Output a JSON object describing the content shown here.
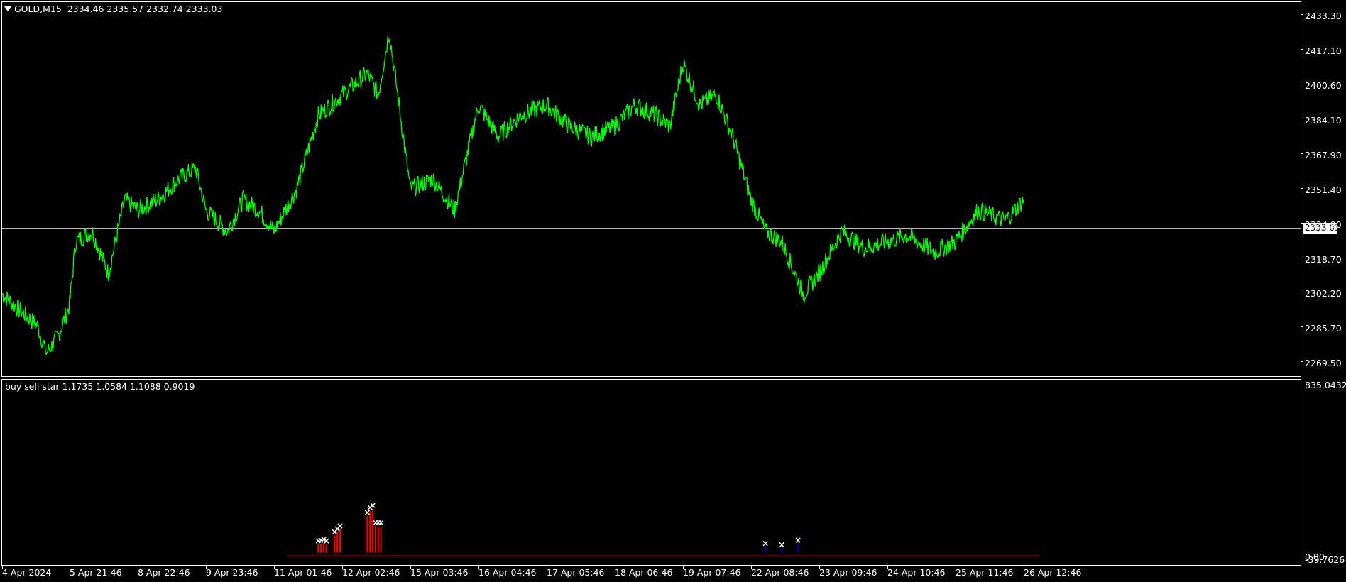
{
  "main_panel": {
    "symbol": "GOLD,M15",
    "ohlc": "2334.46 2335.57 2332.74 2333.03",
    "current_price_label": "2333.03",
    "y_ticks": [
      "2433.30",
      "2417.10",
      "2400.60",
      "2384.10",
      "2367.90",
      "2351.40",
      "2334.90",
      "2318.70",
      "2302.20",
      "2285.70",
      "2269.50"
    ]
  },
  "indicator_panel": {
    "title": "buy sell star 1.1735 1.0584 1.1088 0.9019",
    "y_top": "835.0432",
    "y_bottom": "-39.7626",
    "y_zero": "0.00"
  },
  "x_ticks": [
    "4 Apr 2024",
    "5 Apr 21:46",
    "8 Apr 22:46",
    "9 Apr 23:46",
    "11 Apr 01:46",
    "12 Apr 02:46",
    "15 Apr 03:46",
    "16 Apr 04:46",
    "17 Apr 05:46",
    "18 Apr 06:46",
    "19 Apr 07:46",
    "22 Apr 08:46",
    "23 Apr 09:46",
    "24 Apr 10:46",
    "25 Apr 11:46",
    "26 Apr 12:46"
  ],
  "chart_data": [
    {
      "type": "line",
      "title": "GOLD,M15",
      "series": [
        {
          "name": "GOLD,M15",
          "color": "#00ff00"
        }
      ],
      "x": [
        "4 Apr",
        "5 Apr 00:00",
        "5 Apr 06:00",
        "5 Apr 14:00",
        "5 Apr 21:46",
        "6 Apr 06:00",
        "8 Apr 06:00",
        "8 Apr 12:00",
        "8 Apr 18:00",
        "8 Apr 22:46",
        "9 Apr 06:00",
        "9 Apr 14:00",
        "9 Apr 20:00",
        "9 Apr 23:46",
        "10 Apr 08:00",
        "10 Apr 14:00",
        "10 Apr 20:00",
        "11 Apr 01:46",
        "11 Apr 10:00",
        "11 Apr 18:00",
        "12 Apr 02:46",
        "12 Apr 12:00",
        "12 Apr 16:00",
        "12 Apr 20:00",
        "15 Apr 03:46",
        "15 Apr 12:00",
        "15 Apr 20:00",
        "16 Apr 04:46",
        "16 Apr 12:00",
        "16 Apr 20:00",
        "17 Apr 05:46",
        "17 Apr 14:00",
        "17 Apr 22:00",
        "18 Apr 06:46",
        "18 Apr 14:00",
        "18 Apr 22:00",
        "19 Apr 03:00",
        "19 Apr 07:46",
        "19 Apr 14:00",
        "19 Apr 20:00",
        "22 Apr 02:00",
        "22 Apr 08:46",
        "22 Apr 14:00",
        "22 Apr 20:00",
        "23 Apr 04:00",
        "23 Apr 09:46",
        "23 Apr 18:00",
        "24 Apr 02:00",
        "24 Apr 10:46",
        "24 Apr 18:00",
        "25 Apr 04:00",
        "25 Apr 11:46",
        "25 Apr 20:00",
        "26 Apr 06:00",
        "26 Apr 12:46"
      ],
      "y": [
        2300,
        2285,
        2272,
        2280,
        2295,
        2325,
        2330,
        2310,
        2345,
        2340,
        2345,
        2355,
        2360,
        2340,
        2330,
        2345,
        2340,
        2330,
        2350,
        2385,
        2395,
        2405,
        2395,
        2425,
        2350,
        2355,
        2340,
        2390,
        2375,
        2385,
        2390,
        2380,
        2375,
        2380,
        2390,
        2385,
        2380,
        2410,
        2390,
        2395,
        2375,
        2345,
        2330,
        2325,
        2300,
        2310,
        2330,
        2322,
        2325,
        2328,
        2320,
        2325,
        2340,
        2335,
        2345,
        2333
      ],
      "ylim": [
        2261.0,
        2439.0
      ]
    },
    {
      "type": "bar",
      "title": "buy sell star 1.1735 1.0584 1.1088 0.9019",
      "series": [
        {
          "name": "sell",
          "color": "#ff0000",
          "x": [
            "11 Apr 18:00",
            "11 Apr 19:00",
            "11 Apr 20:00",
            "11 Apr 21:00",
            "12 Apr 00:00",
            "12 Apr 01:00",
            "12 Apr 02:00",
            "12 Apr 12:00",
            "12 Apr 13:00",
            "12 Apr 14:00",
            "12 Apr 15:00",
            "12 Apr 16:00",
            "12 Apr 17:00"
          ],
          "values": [
            40,
            45,
            48,
            40,
            85,
            100,
            115,
            180,
            205,
            215,
            130,
            130,
            130
          ]
        },
        {
          "name": "buy",
          "color": "#0000cc",
          "x": [
            "22 Apr 14:00",
            "22 Apr 20:00",
            "23 Apr 02:00"
          ],
          "values": [
            28,
            22,
            45
          ]
        }
      ],
      "ylim": [
        -39.7626,
        835.0432
      ]
    }
  ]
}
